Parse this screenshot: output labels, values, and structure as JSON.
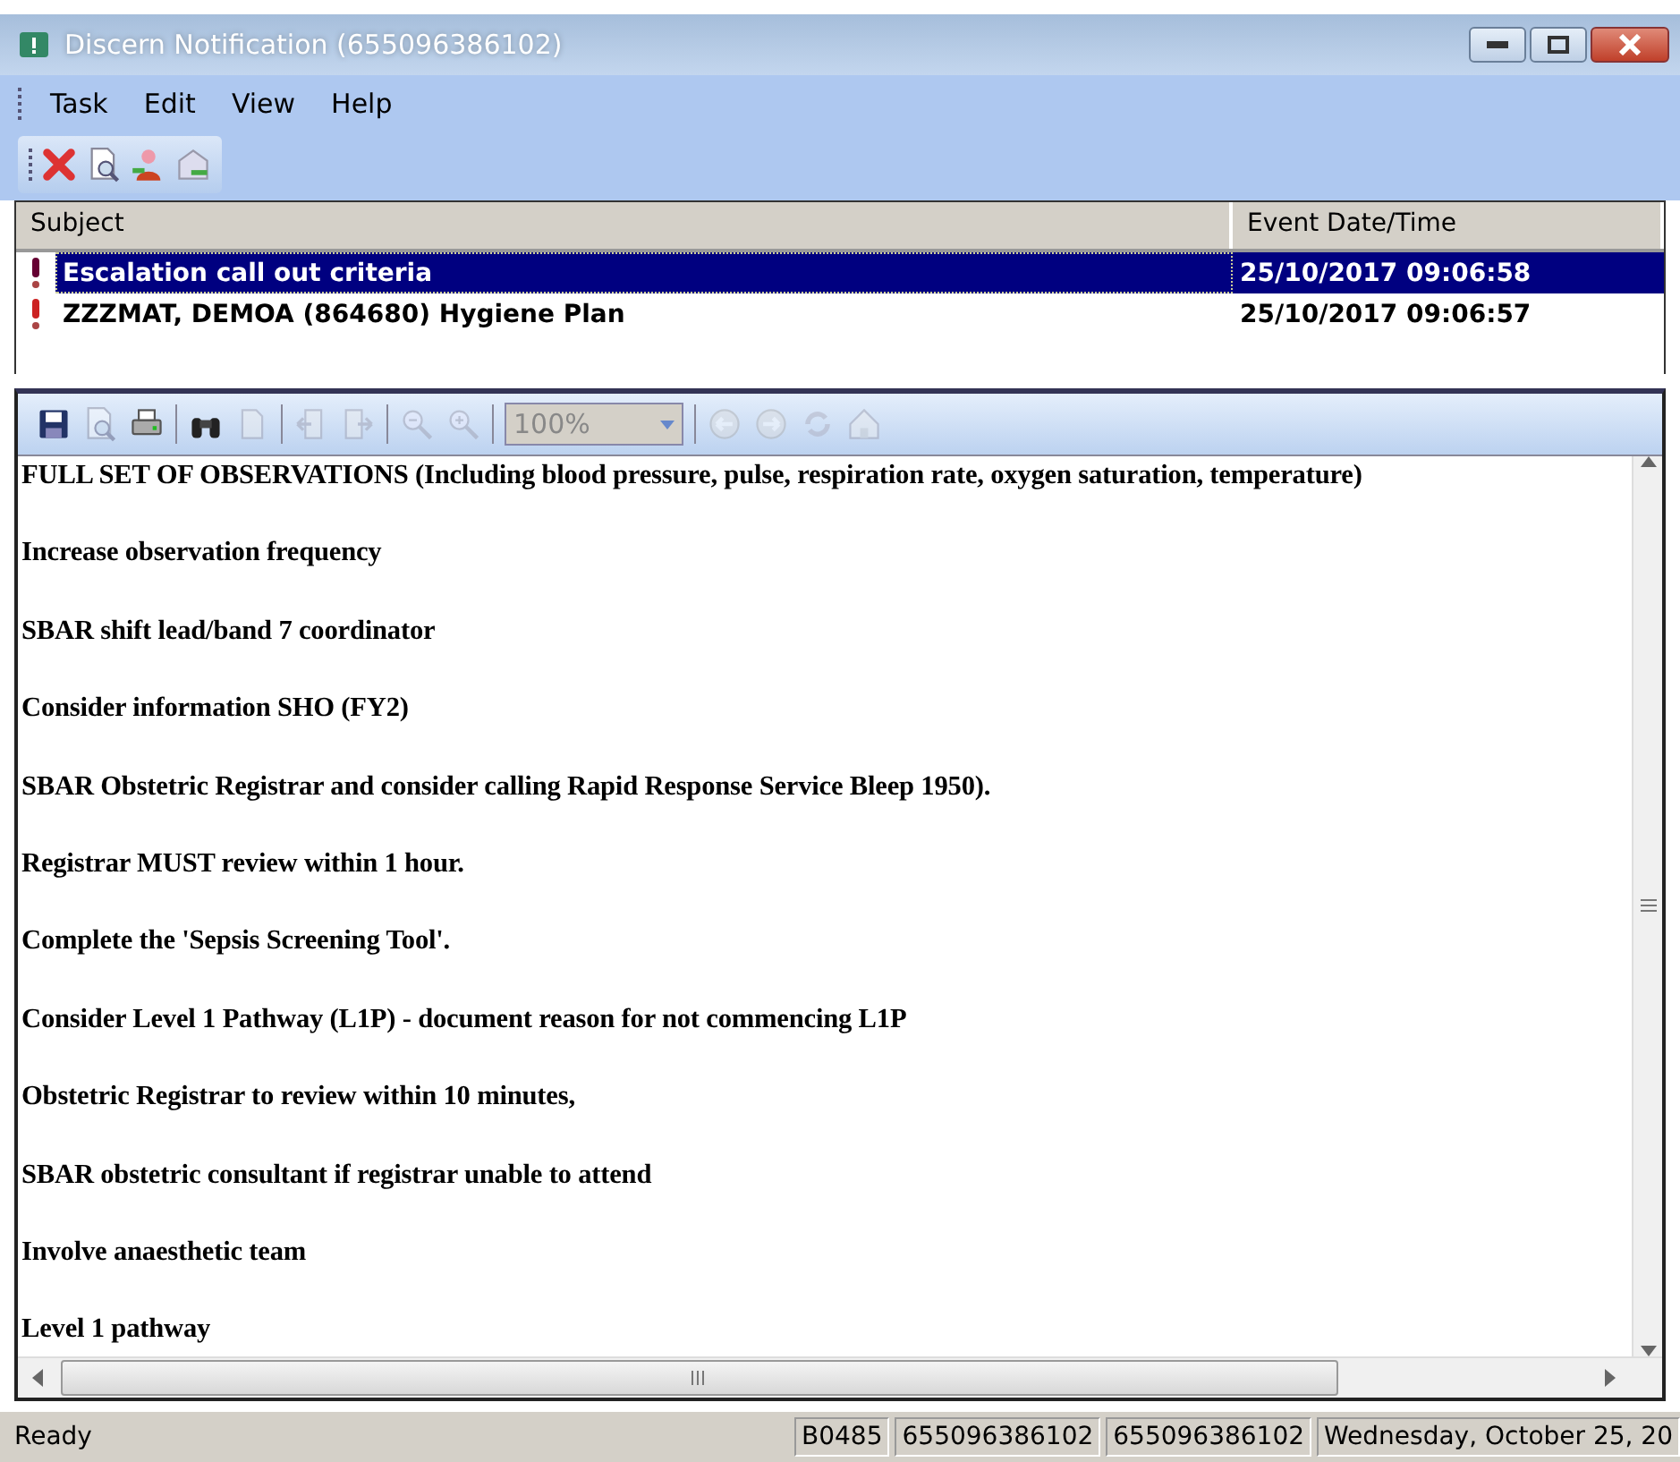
{
  "window": {
    "title": "Discern Notification (655096386102)"
  },
  "menu": [
    "Task",
    "Edit",
    "View",
    "Help"
  ],
  "toolbar": [
    {
      "kind": "delete"
    },
    {
      "kind": "preview"
    },
    {
      "kind": "person"
    },
    {
      "kind": "mail"
    }
  ],
  "list": {
    "columns": [
      "Subject",
      "Event Date/Time"
    ],
    "rows": [
      {
        "subject": "Escalation call out criteria",
        "datetime": "25/10/2017 09:06:58",
        "selected": true
      },
      {
        "subject": "ZZZMAT, DEMOA (864680) Hygiene Plan",
        "datetime": "25/10/2017 09:06:57",
        "selected": false
      }
    ]
  },
  "viewer_toolbar": {
    "tools": [
      {
        "kind": "save",
        "disabled": false
      },
      {
        "kind": "preview",
        "disabled": true
      },
      {
        "kind": "print",
        "disabled": false
      },
      {
        "kind": "sep"
      },
      {
        "kind": "find",
        "disabled": false
      },
      {
        "kind": "page",
        "disabled": true
      },
      {
        "kind": "sep"
      },
      {
        "kind": "back-page",
        "disabled": true
      },
      {
        "kind": "forward-page",
        "disabled": true
      },
      {
        "kind": "sep"
      },
      {
        "kind": "zoom-out",
        "disabled": true
      },
      {
        "kind": "zoom-in",
        "disabled": true
      },
      {
        "kind": "sep"
      },
      {
        "kind": "zoom"
      },
      {
        "kind": "sep"
      },
      {
        "kind": "back",
        "disabled": true
      },
      {
        "kind": "forward",
        "disabled": true
      },
      {
        "kind": "refresh",
        "disabled": true
      },
      {
        "kind": "home",
        "disabled": true
      }
    ],
    "zoom": "100%"
  },
  "document": {
    "lines": [
      "FULL SET OF OBSERVATIONS  (Including blood pressure, pulse, respiration rate, oxygen saturation, temperature)",
      "Increase observation frequency",
      "SBAR shift lead/band 7 coordinator",
      "Consider information SHO (FY2)",
      "SBAR Obstetric Registrar and consider calling Rapid Response Service Bleep 1950).",
      "Registrar MUST review within 1 hour.",
      "Complete the 'Sepsis Screening Tool'.",
      "Consider Level 1 Pathway (L1P) - document reason for not commencing L1P",
      "Obstetric Registrar to review within 10 minutes,",
      "SBAR obstetric consultant if registrar unable to attend",
      "Involve anaesthetic team",
      "Level 1 pathway"
    ]
  },
  "status_bar": {
    "message": "Ready",
    "panels": [
      "B0485",
      "655096386102",
      "655096386102",
      "Wednesday, October 25, 20"
    ]
  }
}
